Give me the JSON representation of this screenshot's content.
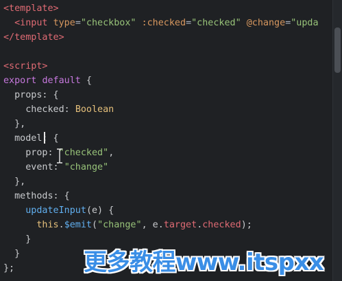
{
  "code_lines": [
    [
      {
        "c": "tag",
        "t": "<template>"
      }
    ],
    [
      {
        "c": "plain",
        "t": "  "
      },
      {
        "c": "tag",
        "t": "<input"
      },
      {
        "c": "plain",
        "t": " "
      },
      {
        "c": "attr",
        "t": "type"
      },
      {
        "c": "punct",
        "t": "="
      },
      {
        "c": "str",
        "t": "\"checkbox\""
      },
      {
        "c": "plain",
        "t": " "
      },
      {
        "c": "attr",
        "t": ":checked"
      },
      {
        "c": "punct",
        "t": "="
      },
      {
        "c": "str",
        "t": "\"checked\""
      },
      {
        "c": "plain",
        "t": " "
      },
      {
        "c": "attr",
        "t": "@change"
      },
      {
        "c": "punct",
        "t": "="
      },
      {
        "c": "str",
        "t": "\"upda"
      }
    ],
    [
      {
        "c": "tag",
        "t": "</template>"
      }
    ],
    [
      {
        "c": "plain",
        "t": ""
      }
    ],
    [
      {
        "c": "tag",
        "t": "<script>"
      }
    ],
    [
      {
        "c": "kw",
        "t": "export"
      },
      {
        "c": "plain",
        "t": " "
      },
      {
        "c": "kw",
        "t": "default"
      },
      {
        "c": "plain",
        "t": " {"
      }
    ],
    [
      {
        "c": "plain",
        "t": "  props: {"
      }
    ],
    [
      {
        "c": "plain",
        "t": "    checked: "
      },
      {
        "c": "type",
        "t": "Boolean"
      }
    ],
    [
      {
        "c": "plain",
        "t": "  },"
      }
    ],
    [
      {
        "c": "plain",
        "t": "  model: {"
      }
    ],
    [
      {
        "c": "plain",
        "t": "    prop: "
      },
      {
        "c": "str",
        "t": "\"checked\""
      },
      {
        "c": "plain",
        "t": ","
      }
    ],
    [
      {
        "c": "plain",
        "t": "    event: "
      },
      {
        "c": "str",
        "t": "\"change\""
      }
    ],
    [
      {
        "c": "plain",
        "t": "  },"
      }
    ],
    [
      {
        "c": "plain",
        "t": "  methods: {"
      }
    ],
    [
      {
        "c": "plain",
        "t": "    "
      },
      {
        "c": "fn",
        "t": "updateInput"
      },
      {
        "c": "plain",
        "t": "(e) {"
      }
    ],
    [
      {
        "c": "plain",
        "t": "      "
      },
      {
        "c": "thisword",
        "t": "this"
      },
      {
        "c": "plain",
        "t": "."
      },
      {
        "c": "fn",
        "t": "$emit"
      },
      {
        "c": "plain",
        "t": "("
      },
      {
        "c": "str",
        "t": "\"change\""
      },
      {
        "c": "plain",
        "t": ", e."
      },
      {
        "c": "prop",
        "t": "target"
      },
      {
        "c": "plain",
        "t": "."
      },
      {
        "c": "prop",
        "t": "checked"
      },
      {
        "c": "plain",
        "t": ");"
      }
    ],
    [
      {
        "c": "plain",
        "t": "    }"
      }
    ],
    [
      {
        "c": "plain",
        "t": "  }"
      }
    ],
    [
      {
        "c": "plain",
        "t": "};"
      }
    ]
  ],
  "watermark": "更多教程www.itspxx"
}
